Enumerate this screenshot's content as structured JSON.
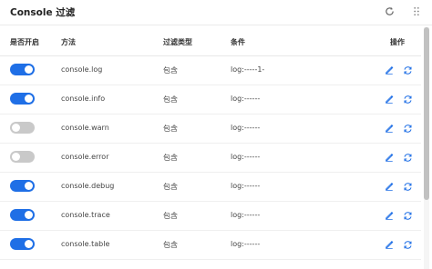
{
  "header": {
    "title": "Console 过滤",
    "refresh_icon": "refresh-icon",
    "more_icon": "more-vertical-icon"
  },
  "table": {
    "columns": [
      "是否开启",
      "方法",
      "过滤类型",
      "条件",
      "操作"
    ],
    "rows": [
      {
        "enabled": true,
        "method": "console.log",
        "filter_type": "包含",
        "condition": "log:-----1-"
      },
      {
        "enabled": true,
        "method": "console.info",
        "filter_type": "包含",
        "condition": "log:------"
      },
      {
        "enabled": false,
        "method": "console.warn",
        "filter_type": "包含",
        "condition": "log:------"
      },
      {
        "enabled": false,
        "method": "console.error",
        "filter_type": "包含",
        "condition": "log:------"
      },
      {
        "enabled": true,
        "method": "console.debug",
        "filter_type": "包含",
        "condition": "log:------"
      },
      {
        "enabled": true,
        "method": "console.trace",
        "filter_type": "包含",
        "condition": "log:------"
      },
      {
        "enabled": true,
        "method": "console.table",
        "filter_type": "包含",
        "condition": "log:------"
      }
    ],
    "action_icons": [
      "edit-icon",
      "sync-icon"
    ]
  },
  "colors": {
    "accent": "#1f6fe6",
    "toggle_off": "#c9c9c9",
    "action_icon": "#1f6fe6"
  }
}
